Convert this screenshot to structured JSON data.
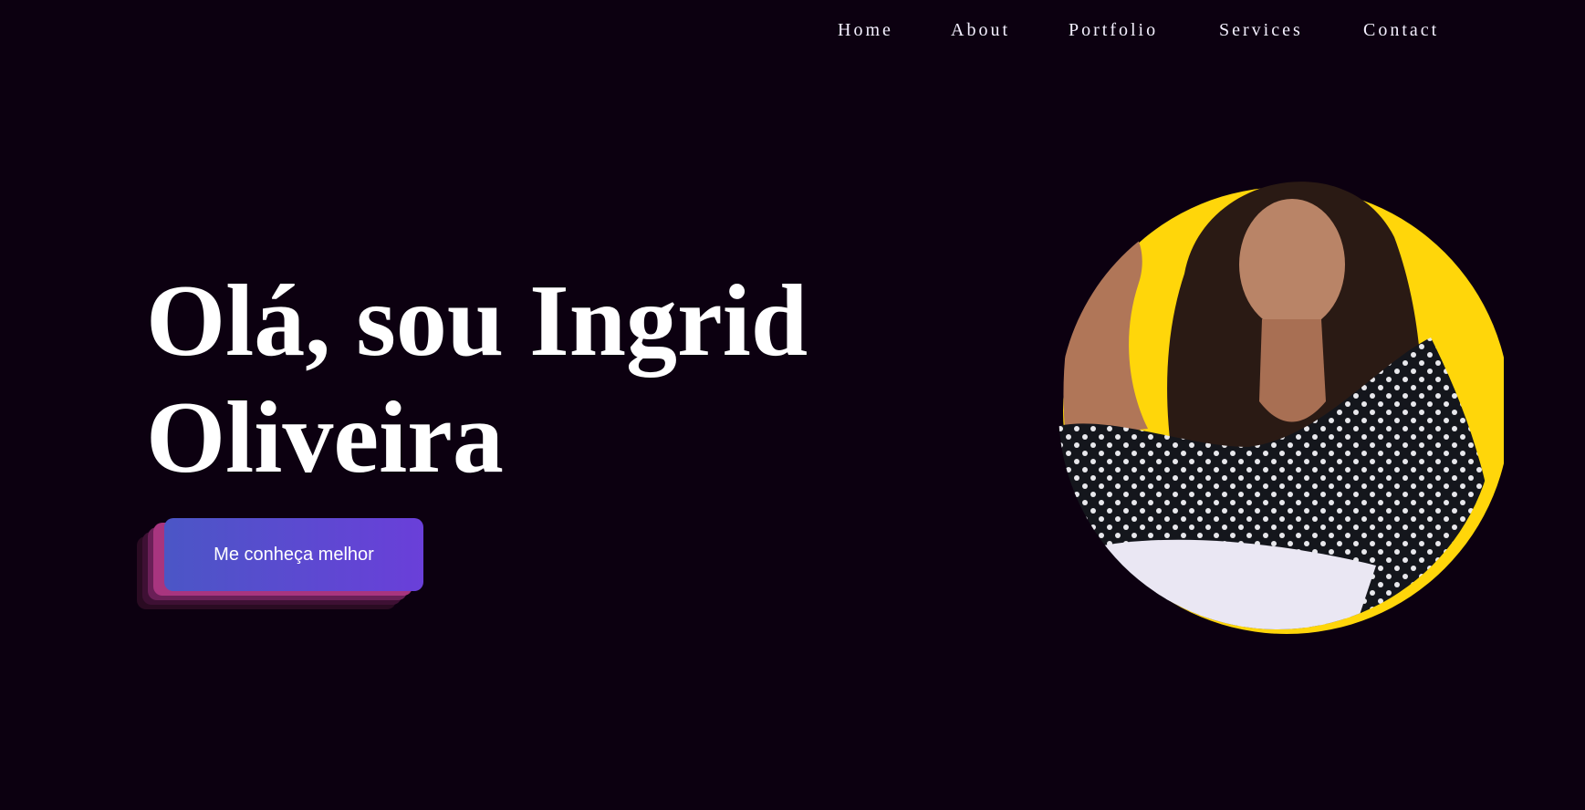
{
  "nav": {
    "items": [
      "Home",
      "About",
      "Portfolio",
      "Services",
      "Contact"
    ]
  },
  "hero": {
    "title": "Olá, sou Ingrid Oliveira",
    "cta_label": "Me conheça melhor"
  },
  "colors": {
    "background": "#0c0010",
    "accent_yellow": "#ffd60a",
    "button_gradient_start": "#4b56c6",
    "button_gradient_end": "#6a3fd9",
    "button_shadow_pink": "#a8357f"
  }
}
